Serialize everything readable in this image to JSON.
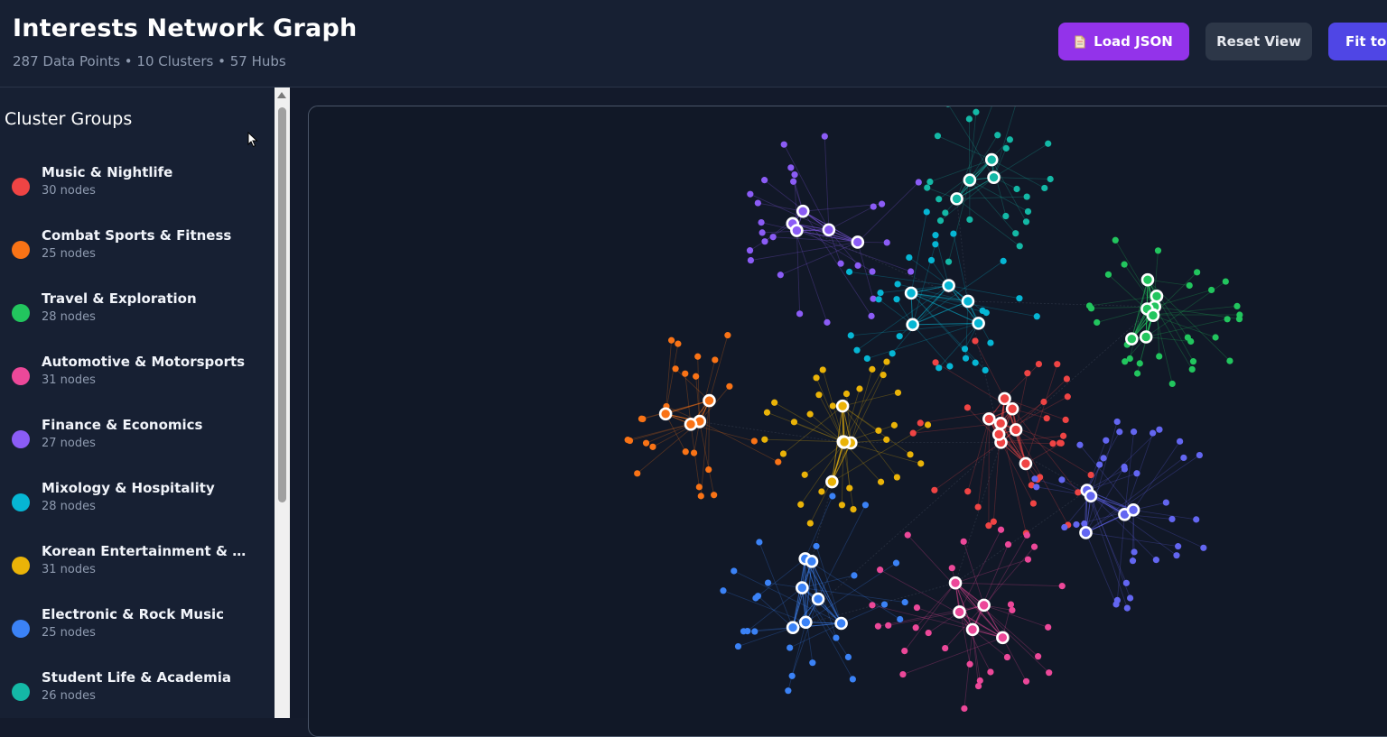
{
  "header": {
    "title": "Interests Network Graph",
    "subtitle": "287 Data Points • 10 Clusters • 57 Hubs",
    "buttons": {
      "load": "Load JSON",
      "reset": "Reset View",
      "fit": "Fit to Screen"
    }
  },
  "sidebar": {
    "title": "Cluster Groups",
    "clusters": [
      {
        "name": "Music & Nightlife",
        "count": "30 nodes",
        "color": "#ef4444"
      },
      {
        "name": "Combat Sports & Fitness",
        "count": "25 nodes",
        "color": "#f97316"
      },
      {
        "name": "Travel & Exploration",
        "count": "28 nodes",
        "color": "#22c55e"
      },
      {
        "name": "Automotive & Motorsports",
        "count": "31 nodes",
        "color": "#ec4899"
      },
      {
        "name": "Finance & Economics",
        "count": "27 nodes",
        "color": "#8b5cf6"
      },
      {
        "name": "Mixology & Hospitality",
        "count": "28 nodes",
        "color": "#06b6d4"
      },
      {
        "name": "Korean Entertainment & Culture",
        "count": "31 nodes",
        "color": "#eab308"
      },
      {
        "name": "Electronic & Rock Music",
        "count": "25 nodes",
        "color": "#3b82f6"
      },
      {
        "name": "Student Life & Academia",
        "count": "26 nodes",
        "color": "#14b8a6"
      }
    ]
  },
  "graph_clusters": [
    {
      "color": "#8b5cf6",
      "hubs": 5,
      "nodes": 27
    },
    {
      "color": "#14b8a6",
      "hubs": 4,
      "nodes": 26
    },
    {
      "color": "#06b6d4",
      "hubs": 5,
      "nodes": 28
    },
    {
      "color": "#22c55e",
      "hubs": 8,
      "nodes": 28
    },
    {
      "color": "#f97316",
      "hubs": 5,
      "nodes": 25
    },
    {
      "color": "#eab308",
      "hubs": 6,
      "nodes": 31
    },
    {
      "color": "#ef4444",
      "hubs": 8,
      "nodes": 30
    },
    {
      "color": "#3b82f6",
      "hubs": 7,
      "nodes": 25
    },
    {
      "color": "#ec4899",
      "hubs": 5,
      "nodes": 31
    },
    {
      "color": "#6366f1",
      "hubs": 5,
      "nodes": 36
    }
  ]
}
